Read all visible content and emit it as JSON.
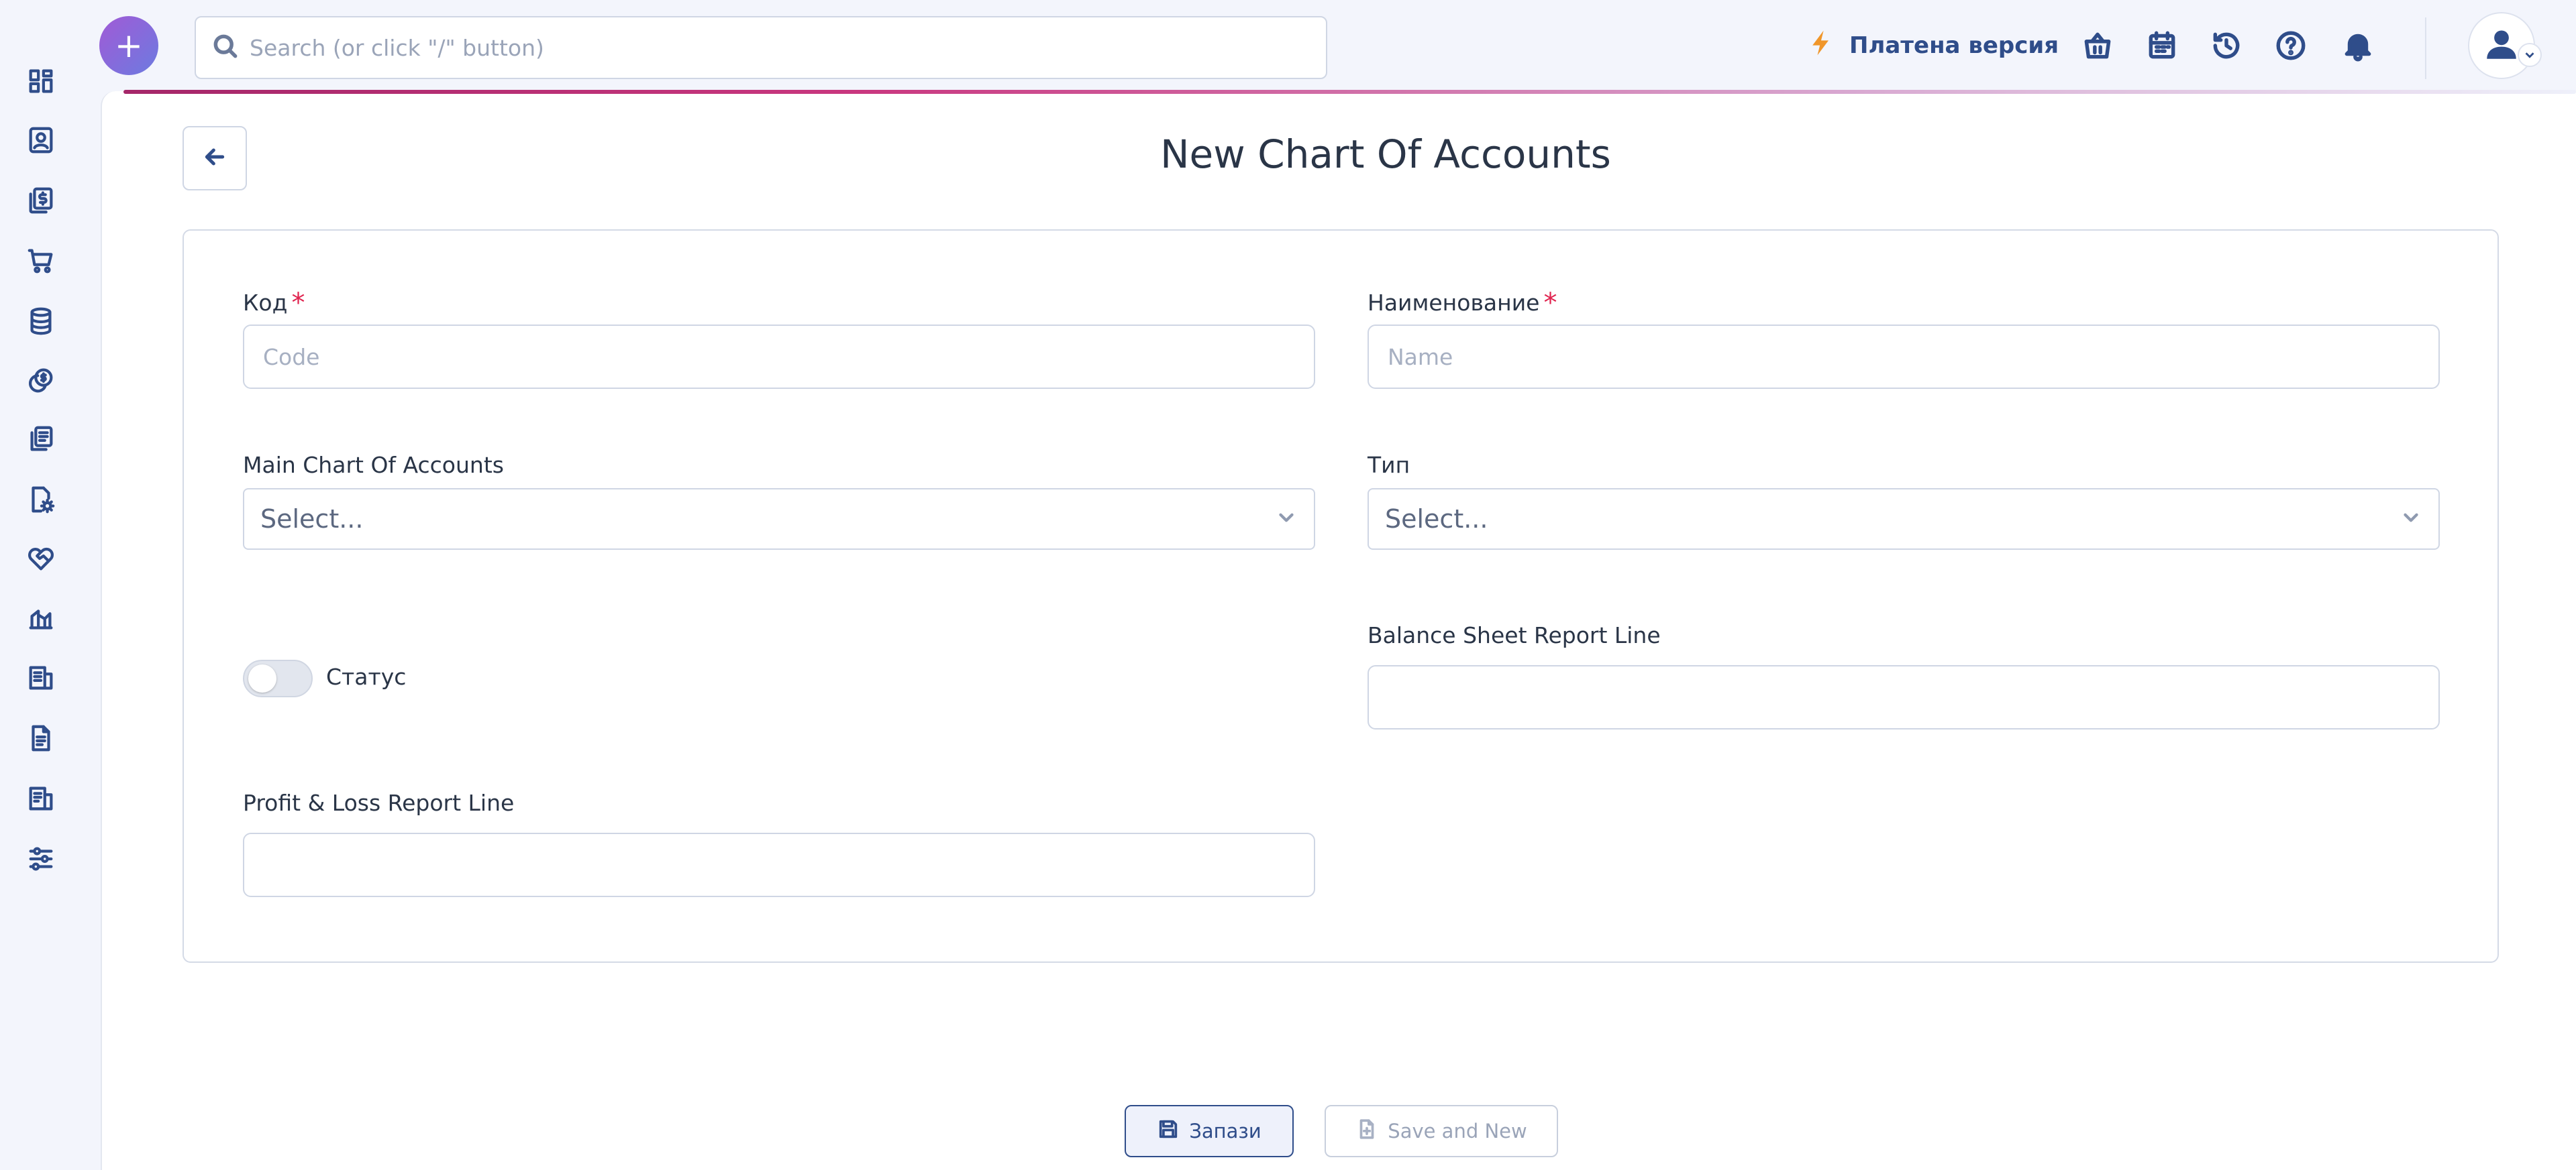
{
  "topbar": {
    "add_button_label": "+",
    "search_placeholder": "Search (or click \"/\" button)",
    "paid_version_label": "Платена версия"
  },
  "sidebar": {
    "items": [
      {
        "icon": "dashboard-icon"
      },
      {
        "icon": "contacts-icon"
      },
      {
        "icon": "invoices-icon"
      },
      {
        "icon": "cart-icon"
      },
      {
        "icon": "database-icon"
      },
      {
        "icon": "coins-icon"
      },
      {
        "icon": "documents-icon"
      },
      {
        "icon": "settings-file-icon"
      },
      {
        "icon": "handshake-icon"
      },
      {
        "icon": "chart-icon"
      },
      {
        "icon": "report-icon"
      },
      {
        "icon": "file-text-icon"
      },
      {
        "icon": "ledger-icon"
      },
      {
        "icon": "sliders-icon"
      }
    ]
  },
  "page": {
    "title": "New Chart Of Accounts"
  },
  "form": {
    "code_label": "Код",
    "code_placeholder": "Code",
    "code_required": "*",
    "name_label": "Наименование",
    "name_placeholder": "Name",
    "name_required": "*",
    "main_chart_label": "Main Chart Of Accounts",
    "main_chart_value": "Select...",
    "type_label": "Тип",
    "type_value": "Select...",
    "status_label": "Статус",
    "status_on": false,
    "balance_sheet_label": "Balance Sheet Report Line",
    "profit_loss_label": "Profit & Loss Report Line"
  },
  "actions": {
    "save_label": "Запази",
    "save_new_label": "Save and New"
  },
  "colors": {
    "primary": "#2f4d8a",
    "accent_orange": "#f0962a",
    "required_red": "#e0244f",
    "add_button_gradient_start": "#a15ad6",
    "add_button_gradient_end": "#6c7be0"
  }
}
